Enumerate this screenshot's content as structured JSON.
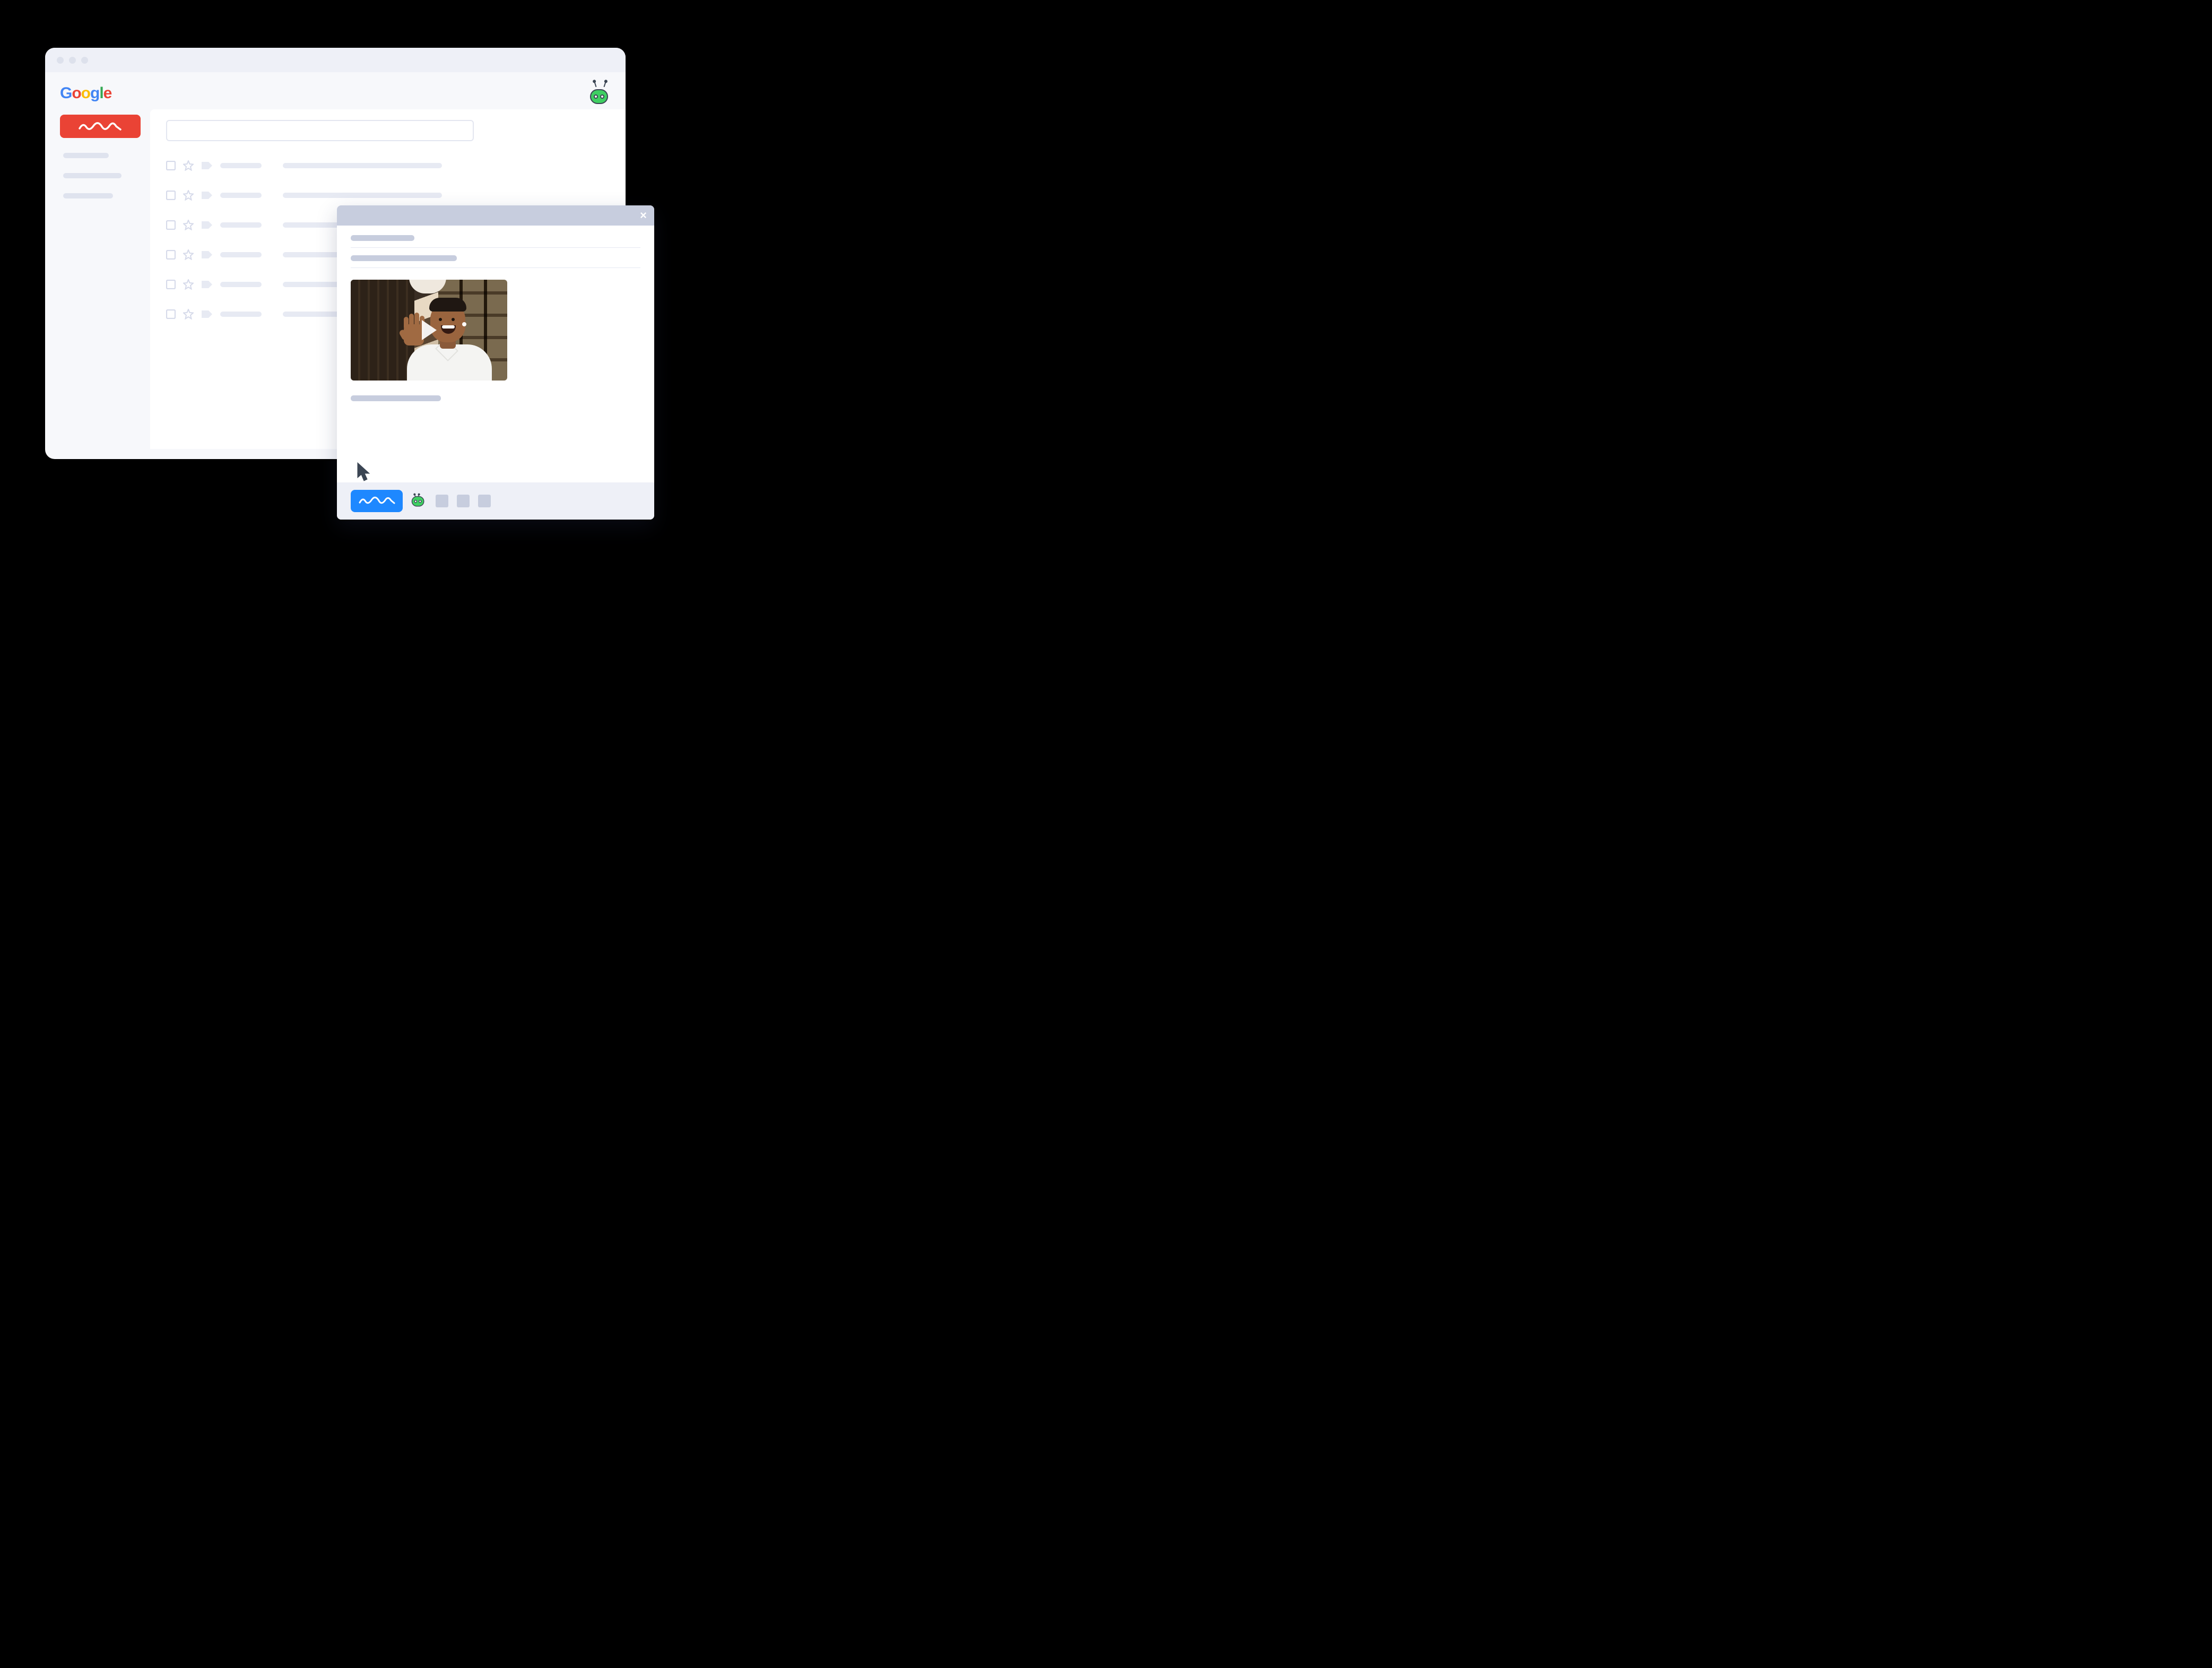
{
  "window": {
    "traffic_lights": 3
  },
  "header": {
    "logo_text": "Google",
    "extension_icon": "bot-icon"
  },
  "sidebar": {
    "compose_icon": "squiggle",
    "item_widths": [
      86,
      110,
      94
    ]
  },
  "inbox": {
    "search_placeholder": "",
    "rows": [
      {
        "line_widths": [
          78,
          300
        ]
      },
      {
        "line_widths": [
          78,
          300
        ]
      },
      {
        "line_widths": [
          78,
          300
        ]
      },
      {
        "line_widths": [
          78,
          300
        ]
      },
      {
        "line_widths": [
          78,
          300
        ]
      },
      {
        "line_widths": [
          78,
          300
        ]
      }
    ]
  },
  "compose": {
    "close_label": "×",
    "to_placeholder_width": 120,
    "subject_placeholder_width": 200,
    "body_line_width": 170,
    "video": {
      "has_play": true,
      "alt": "Person waving hello on webcam"
    },
    "footer": {
      "send_icon": "squiggle",
      "extension_icon": "bot-icon",
      "action_count": 3
    }
  },
  "colors": {
    "accent_red": "#ea4335",
    "accent_blue": "#1e88ff",
    "bot_green": "#3fcf62",
    "placeholder": "#c7cdde"
  }
}
